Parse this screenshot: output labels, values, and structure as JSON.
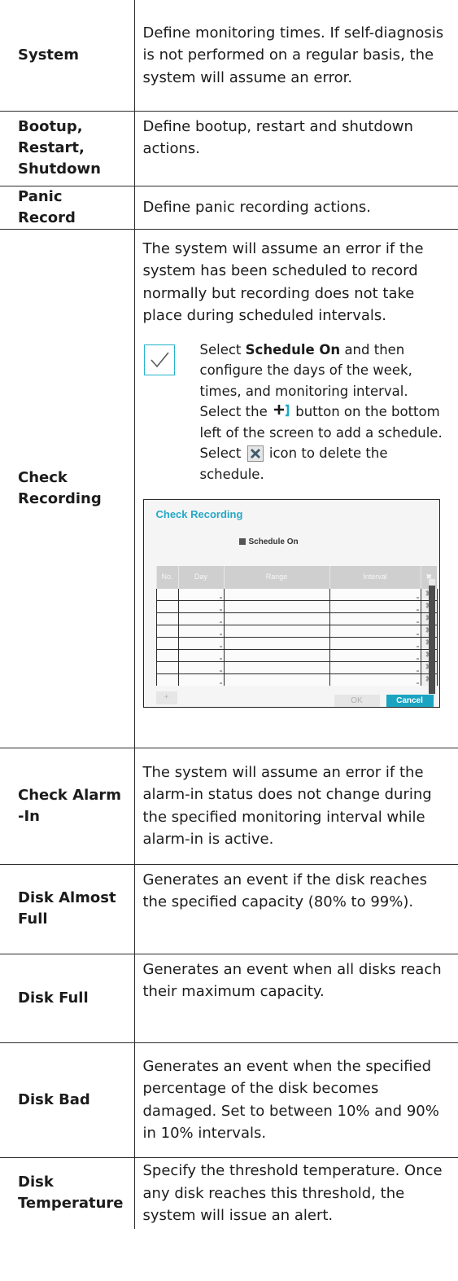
{
  "colors": {
    "accent": "#23a9c9",
    "border": "#2d2d2d",
    "text": "#1c1c1c"
  },
  "rows": [
    {
      "term": "System",
      "desc": "Define monitoring times. If self-diagnosis is not performed on a regular basis, the system will assume an error."
    },
    {
      "term": "Bootup, Restart, Shutdown",
      "desc": "Define bootup, restart and shutdown actions."
    },
    {
      "term": "Panic Record",
      "desc": "Define panic recording actions."
    },
    {
      "term": "Check Recording",
      "desc": "The system will assume an error if the system has been scheduled to record normally but recording does not take place during scheduled intervals."
    },
    {
      "term": "Check Alarm-In",
      "desc": "The system will assume an error if the alarm-in status does not change during the specified monitoring interval while alarm-in is active."
    },
    {
      "term": "Disk Almost Full",
      "desc": "Generates an event if the disk reaches the specified capacity (80% to 99%)."
    },
    {
      "term": "Disk Full",
      "desc": "Generates an event when all disks reach their maximum capacity."
    },
    {
      "term": "Disk Bad",
      "desc": "Generates an event when the specified percentage of the disk becomes damaged. Set to between 10% and 90% in 10% intervals."
    },
    {
      "term": "Disk Temperature",
      "desc": "Specify the threshold temperature. Once any disk reaches this threshold, the system will issue an alert."
    }
  ],
  "note": {
    "icon": "checkmark-icon",
    "select": "Select",
    "schedule_on": "Schedule On",
    "part1": "and then configure the days of the week, times, and monitoring interval. Select the",
    "part2": "button on the bottom left of the screen to add a schedule. Select",
    "part3": "icon to delete the schedule.",
    "add_icon": "plus-icon",
    "delete_icon": "x-icon"
  },
  "dialog": {
    "title": "Check Recording",
    "checkbox_label": "Schedule On",
    "columns": {
      "no": "No.",
      "day": "Day",
      "range": "Range",
      "interval": "Interval",
      "delete": "✖"
    },
    "add_label": "+",
    "ok_label": "OK",
    "cancel_label": "Cancel"
  }
}
